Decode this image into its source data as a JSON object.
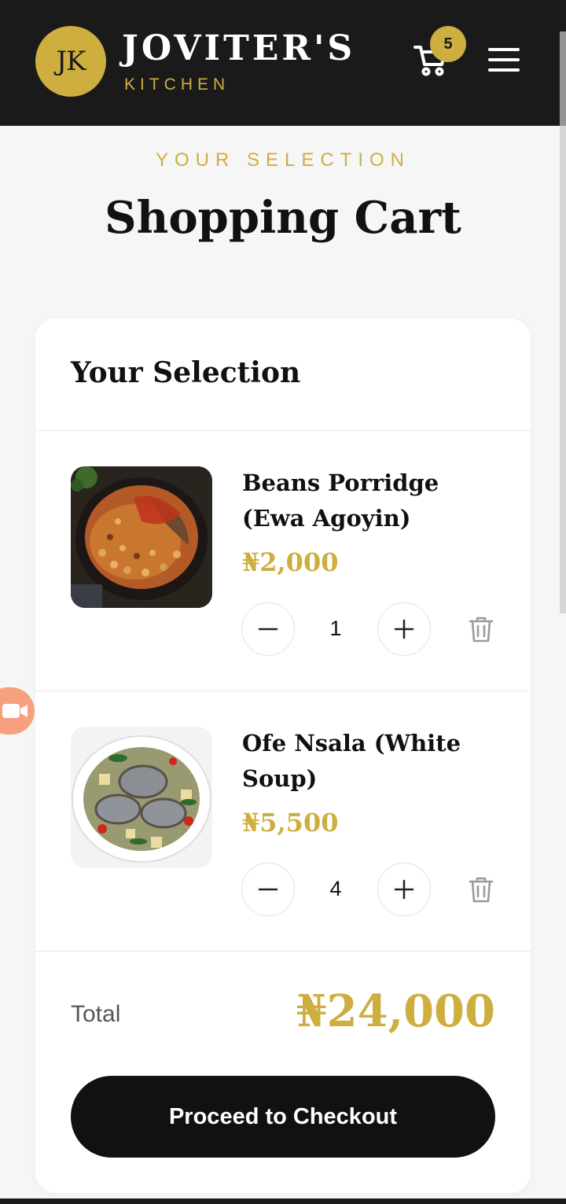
{
  "header": {
    "logo_initials": "JK",
    "brand_name": "JOVITER'S",
    "brand_sub": "KITCHEN",
    "cart_count": "5"
  },
  "page": {
    "eyebrow": "YOUR SELECTION",
    "title": "Shopping Cart"
  },
  "cart": {
    "heading": "Your Selection",
    "items": [
      {
        "name": "Beans Porridge (Ewa Agoyin)",
        "price": "₦2,000",
        "quantity": "1",
        "image": "beans-porridge-photo"
      },
      {
        "name": "Ofe Nsala (White Soup)",
        "price": "₦5,500",
        "quantity": "4",
        "image": "white-soup-photo"
      }
    ],
    "total_label": "Total",
    "total_value": "₦24,000",
    "checkout_label": "Proceed to Checkout"
  },
  "colors": {
    "accent": "#cfae40",
    "header_bg": "#1a1a1a",
    "page_bg": "#f6f6f6",
    "button_bg": "#111111",
    "floating_button": "#f6a07e"
  },
  "icons": [
    "cart-icon",
    "menu-icon",
    "minus-icon",
    "plus-icon",
    "trash-icon",
    "video-icon"
  ]
}
